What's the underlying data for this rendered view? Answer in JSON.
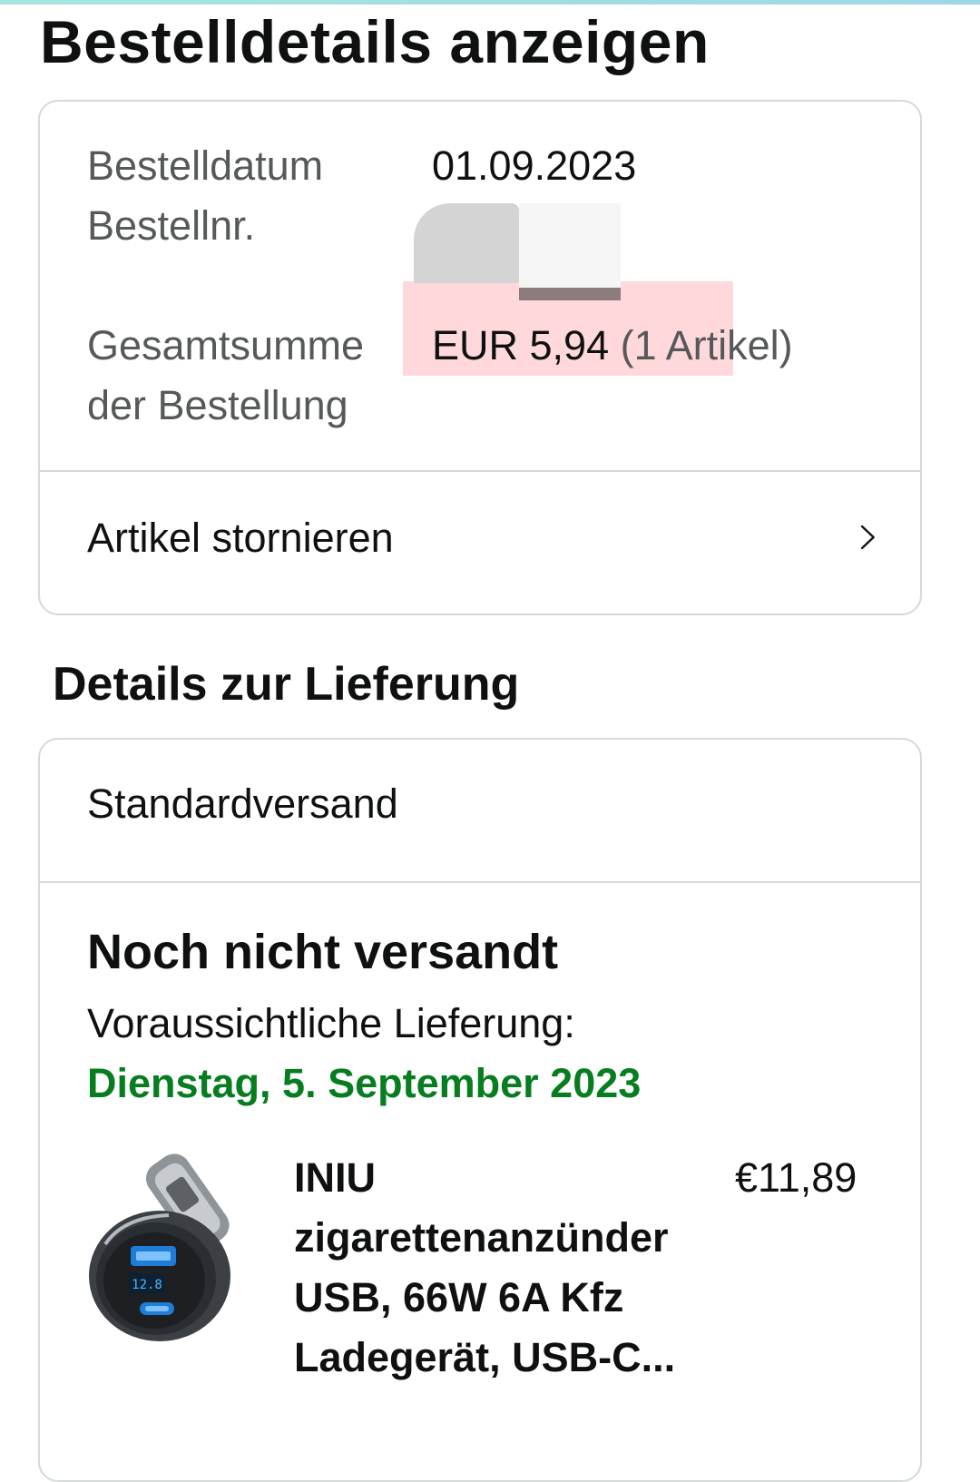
{
  "page": {
    "title": "Bestelldetails anzeigen"
  },
  "summary": {
    "order_date_label": "Bestelldatum",
    "order_date": "01.09.2023",
    "order_number_label": "Bestellnr.",
    "total_label_line1": "Gesamtsumme",
    "total_label_line2": "der Bestellung",
    "total_amount": "EUR 5,94",
    "total_items": "(1 Artikel)",
    "cancel_label": "Artikel stornieren",
    "chevron_icon": "chevron-right-icon"
  },
  "delivery": {
    "section_title": "Details zur Lieferung",
    "shipping_method": "Standardversand",
    "status": "Noch nicht versandt",
    "estimate_label": "Voraussichtliche Lieferung:",
    "estimate_date": "Dienstag, 5. September 2023",
    "estimate_color": "#067d1f"
  },
  "item": {
    "image_icon": "car-charger-product-image",
    "title": "INIU zigarettenanzünder USB, 66W 6A Kfz Ladegerät, USB-C...",
    "price": "€11,89"
  },
  "colors": {
    "border": "#d5d9d9",
    "secondary_text": "#565959",
    "highlight": "#ffbec4"
  }
}
